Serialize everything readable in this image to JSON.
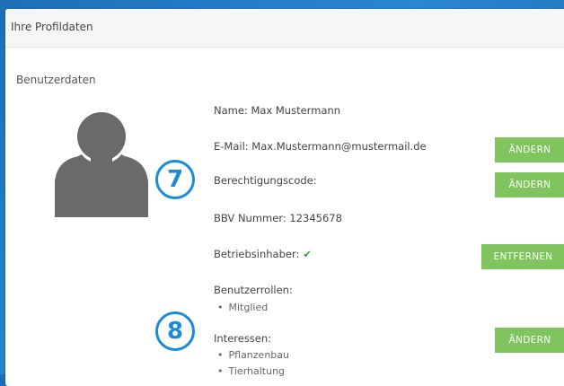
{
  "profile": {
    "title": "Ihre Profildaten",
    "section_title": "Benutzerdaten",
    "name": "Name: Max Mustermann",
    "email": "E-Mail: Max.Mustermann@mustermail.de",
    "permission_code": "Berechtigungscode:",
    "bbv_number": "BBV Nummer: 12345678",
    "owner_label": "Betriebsinhaber:",
    "owner_check": "✔",
    "roles_label": "Benutzerrollen:",
    "roles": [
      "Mitglied"
    ],
    "interests_label": "Interessen:",
    "interests": [
      "Pflanzenbau",
      "Tierhaltung"
    ]
  },
  "buttons": {
    "email_change": "ÄNDERN",
    "code_change": "ÄNDERN",
    "owner_remove": "ENTFERNEN",
    "interests_change": "ÄNDERN"
  },
  "badges": {
    "seven": "7",
    "eight": "8"
  },
  "colors": {
    "button": "#7fc45d",
    "badge": "#1a8bd6",
    "check": "#3e9a47",
    "background": "#1d6fb8"
  },
  "icons": {
    "avatar": "user-silhouette-icon",
    "check": "check-icon"
  }
}
